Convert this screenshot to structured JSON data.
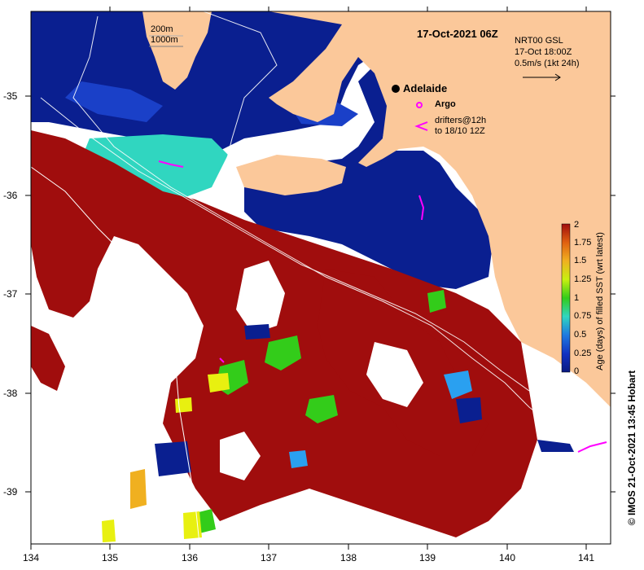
{
  "title": "17-Oct-2021 06Z",
  "contours": {
    "line1": "200m",
    "line2": "1000m"
  },
  "city": {
    "name": "Adelaide"
  },
  "legend": {
    "argo": "Argo",
    "drifters_line1": "drifters@12h",
    "drifters_line2": "to 18/10 12Z"
  },
  "current_key": {
    "line1": "NRT00 GSL",
    "line2": "17-Oct 18:00Z",
    "line3": "0.5m/s (1kt 24h)"
  },
  "colorbar": {
    "label": "Age (days) of filled SST (wrt latest)",
    "ticks": [
      "0",
      "0.25",
      "0.5",
      "0.75",
      "1",
      "1.25",
      "1.5",
      "1.75",
      "2"
    ]
  },
  "x_ticks": [
    "134",
    "135",
    "136",
    "137",
    "138",
    "139",
    "140",
    "141"
  ],
  "y_ticks": [
    "-35",
    "-36",
    "-37",
    "-38",
    "-39"
  ],
  "credit": "©  IMOS 21-Oct-2021 13:45 Hobart",
  "colors": {
    "land": "#fbc89a",
    "old_sst": "#a00d0d",
    "dark_blue": "#0a1f90",
    "cyan": "#30d6c0",
    "green": "#33cc1a",
    "yellow": "#e8f010",
    "orange": "#f0b020",
    "argo": "#ff00ff"
  }
}
